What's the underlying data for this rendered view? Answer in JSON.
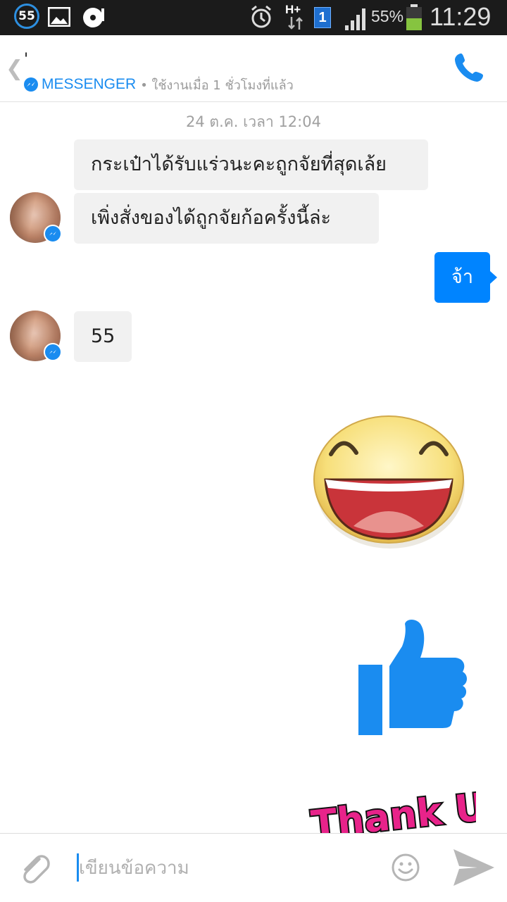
{
  "status_bar": {
    "notification_count": "55",
    "network": "H+",
    "sim": "1",
    "battery": "55%",
    "time": "11:29"
  },
  "header": {
    "back_icon": "chevron-left-icon",
    "contact_name": "'",
    "platform_label": "MESSENGER",
    "presence": "• ใช้งานเมื่อ 1 ชั่วโมงที่แล้ว",
    "call_icon": "phone-icon"
  },
  "conversation": {
    "timestamp": "24 ต.ค. เวลา 12:04",
    "messages": [
      {
        "from": "them",
        "text": "กระเป๋าได้รับแร่วนะคะถูกจัยที่สุดเล้ย"
      },
      {
        "from": "them",
        "text": "เพิ่งสั่งของได้ถูกจัยก้อครั้งนี้ล่ะ"
      },
      {
        "from": "me",
        "text": "จ้า"
      },
      {
        "from": "them",
        "text": "55"
      }
    ],
    "stickers": [
      {
        "name": "laughing-face-sticker"
      },
      {
        "name": "thumbs-up-sticker"
      },
      {
        "name": "thank-u-sticker",
        "text": "Thank U"
      }
    ]
  },
  "composer": {
    "attach_icon": "paperclip-icon",
    "placeholder": "เขียนข้อความ",
    "emoji_icon": "smiley-icon",
    "send_icon": "send-icon"
  },
  "colors": {
    "accent": "#0084ff",
    "incoming_bubble": "#f1f1f1",
    "status_bar": "#1b1b1b"
  }
}
